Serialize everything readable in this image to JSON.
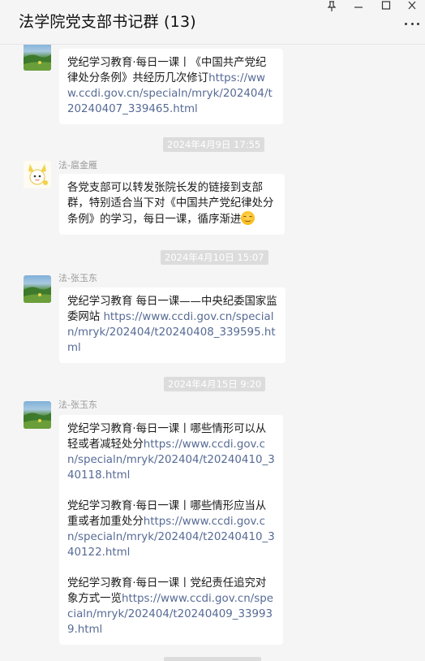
{
  "window": {
    "title": "法学院党支部书记群 (13)",
    "controls": [
      "pin-icon",
      "minimize-icon",
      "maximize-icon",
      "close-icon"
    ],
    "more_icon": "more-dots-icon"
  },
  "messages": {
    "m1": {
      "text": "党纪学习教育·每日一课丨《中国共产党纪律处分条例》共经历几次修订",
      "link": "https://www.ccdi.gov.cn/specialn/mryk/202404/t20240407_339465.html"
    },
    "ts1": "2024年4月9日 17:55",
    "m2": {
      "sender": "法-扈金雁",
      "text": "各党支部可以转发张院长发的链接到支部群，特别适合当下对《中国共产党纪律处分条例》的学习，每日一课，循序渐进",
      "emoji": "smile-emoji"
    },
    "ts2": "2024年4月10日 15:07",
    "m3": {
      "sender": "法-张玉东",
      "text": "党纪学习教育 每日一课——中央纪委国家监委网站",
      "link": "https://www.ccdi.gov.cn/specialn/mryk/202404/t20240408_339595.html"
    },
    "ts3": "2024年4月15日 9:20",
    "m4": {
      "sender": "法-张玉东",
      "items": [
        {
          "text": "党纪学习教育·每日一课丨哪些情形可以从轻或者减轻处分",
          "link": "https://www.ccdi.gov.cn/specialn/mryk/202404/t20240410_340118.html"
        },
        {
          "text": "党纪学习教育·每日一课丨哪些情形应当从重或者加重处分",
          "link": "https://www.ccdi.gov.cn/specialn/mryk/202404/t20240410_340122.html"
        },
        {
          "text": "党纪学习教育·每日一课丨党纪责任追究对象方式一览",
          "link": "https://www.ccdi.gov.cn/specialn/mryk/202404/t20240409_339939.html"
        }
      ]
    }
  }
}
